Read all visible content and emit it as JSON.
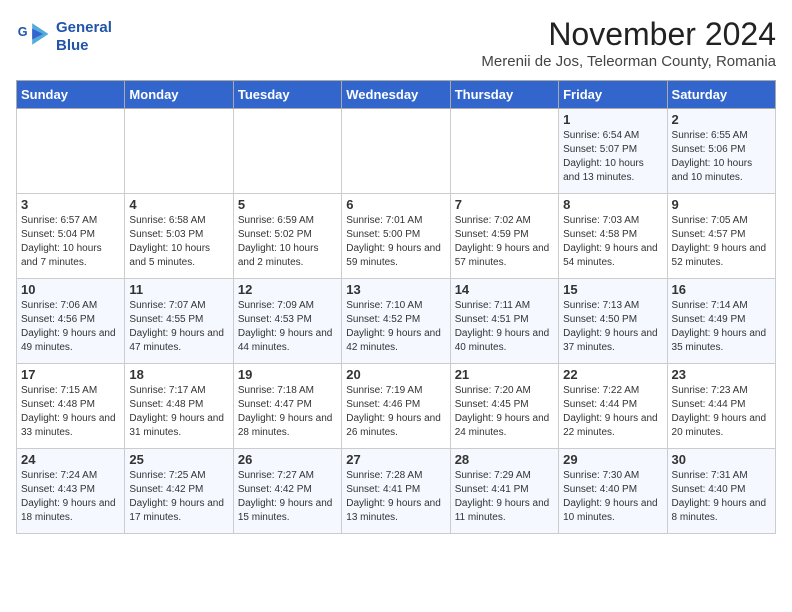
{
  "header": {
    "logo_line1": "General",
    "logo_line2": "Blue",
    "month_title": "November 2024",
    "location": "Merenii de Jos, Teleorman County, Romania"
  },
  "weekdays": [
    "Sunday",
    "Monday",
    "Tuesday",
    "Wednesday",
    "Thursday",
    "Friday",
    "Saturday"
  ],
  "weeks": [
    [
      {
        "day": "",
        "info": ""
      },
      {
        "day": "",
        "info": ""
      },
      {
        "day": "",
        "info": ""
      },
      {
        "day": "",
        "info": ""
      },
      {
        "day": "",
        "info": ""
      },
      {
        "day": "1",
        "info": "Sunrise: 6:54 AM\nSunset: 5:07 PM\nDaylight: 10 hours and 13 minutes."
      },
      {
        "day": "2",
        "info": "Sunrise: 6:55 AM\nSunset: 5:06 PM\nDaylight: 10 hours and 10 minutes."
      }
    ],
    [
      {
        "day": "3",
        "info": "Sunrise: 6:57 AM\nSunset: 5:04 PM\nDaylight: 10 hours and 7 minutes."
      },
      {
        "day": "4",
        "info": "Sunrise: 6:58 AM\nSunset: 5:03 PM\nDaylight: 10 hours and 5 minutes."
      },
      {
        "day": "5",
        "info": "Sunrise: 6:59 AM\nSunset: 5:02 PM\nDaylight: 10 hours and 2 minutes."
      },
      {
        "day": "6",
        "info": "Sunrise: 7:01 AM\nSunset: 5:00 PM\nDaylight: 9 hours and 59 minutes."
      },
      {
        "day": "7",
        "info": "Sunrise: 7:02 AM\nSunset: 4:59 PM\nDaylight: 9 hours and 57 minutes."
      },
      {
        "day": "8",
        "info": "Sunrise: 7:03 AM\nSunset: 4:58 PM\nDaylight: 9 hours and 54 minutes."
      },
      {
        "day": "9",
        "info": "Sunrise: 7:05 AM\nSunset: 4:57 PM\nDaylight: 9 hours and 52 minutes."
      }
    ],
    [
      {
        "day": "10",
        "info": "Sunrise: 7:06 AM\nSunset: 4:56 PM\nDaylight: 9 hours and 49 minutes."
      },
      {
        "day": "11",
        "info": "Sunrise: 7:07 AM\nSunset: 4:55 PM\nDaylight: 9 hours and 47 minutes."
      },
      {
        "day": "12",
        "info": "Sunrise: 7:09 AM\nSunset: 4:53 PM\nDaylight: 9 hours and 44 minutes."
      },
      {
        "day": "13",
        "info": "Sunrise: 7:10 AM\nSunset: 4:52 PM\nDaylight: 9 hours and 42 minutes."
      },
      {
        "day": "14",
        "info": "Sunrise: 7:11 AM\nSunset: 4:51 PM\nDaylight: 9 hours and 40 minutes."
      },
      {
        "day": "15",
        "info": "Sunrise: 7:13 AM\nSunset: 4:50 PM\nDaylight: 9 hours and 37 minutes."
      },
      {
        "day": "16",
        "info": "Sunrise: 7:14 AM\nSunset: 4:49 PM\nDaylight: 9 hours and 35 minutes."
      }
    ],
    [
      {
        "day": "17",
        "info": "Sunrise: 7:15 AM\nSunset: 4:48 PM\nDaylight: 9 hours and 33 minutes."
      },
      {
        "day": "18",
        "info": "Sunrise: 7:17 AM\nSunset: 4:48 PM\nDaylight: 9 hours and 31 minutes."
      },
      {
        "day": "19",
        "info": "Sunrise: 7:18 AM\nSunset: 4:47 PM\nDaylight: 9 hours and 28 minutes."
      },
      {
        "day": "20",
        "info": "Sunrise: 7:19 AM\nSunset: 4:46 PM\nDaylight: 9 hours and 26 minutes."
      },
      {
        "day": "21",
        "info": "Sunrise: 7:20 AM\nSunset: 4:45 PM\nDaylight: 9 hours and 24 minutes."
      },
      {
        "day": "22",
        "info": "Sunrise: 7:22 AM\nSunset: 4:44 PM\nDaylight: 9 hours and 22 minutes."
      },
      {
        "day": "23",
        "info": "Sunrise: 7:23 AM\nSunset: 4:44 PM\nDaylight: 9 hours and 20 minutes."
      }
    ],
    [
      {
        "day": "24",
        "info": "Sunrise: 7:24 AM\nSunset: 4:43 PM\nDaylight: 9 hours and 18 minutes."
      },
      {
        "day": "25",
        "info": "Sunrise: 7:25 AM\nSunset: 4:42 PM\nDaylight: 9 hours and 17 minutes."
      },
      {
        "day": "26",
        "info": "Sunrise: 7:27 AM\nSunset: 4:42 PM\nDaylight: 9 hours and 15 minutes."
      },
      {
        "day": "27",
        "info": "Sunrise: 7:28 AM\nSunset: 4:41 PM\nDaylight: 9 hours and 13 minutes."
      },
      {
        "day": "28",
        "info": "Sunrise: 7:29 AM\nSunset: 4:41 PM\nDaylight: 9 hours and 11 minutes."
      },
      {
        "day": "29",
        "info": "Sunrise: 7:30 AM\nSunset: 4:40 PM\nDaylight: 9 hours and 10 minutes."
      },
      {
        "day": "30",
        "info": "Sunrise: 7:31 AM\nSunset: 4:40 PM\nDaylight: 9 hours and 8 minutes."
      }
    ]
  ]
}
